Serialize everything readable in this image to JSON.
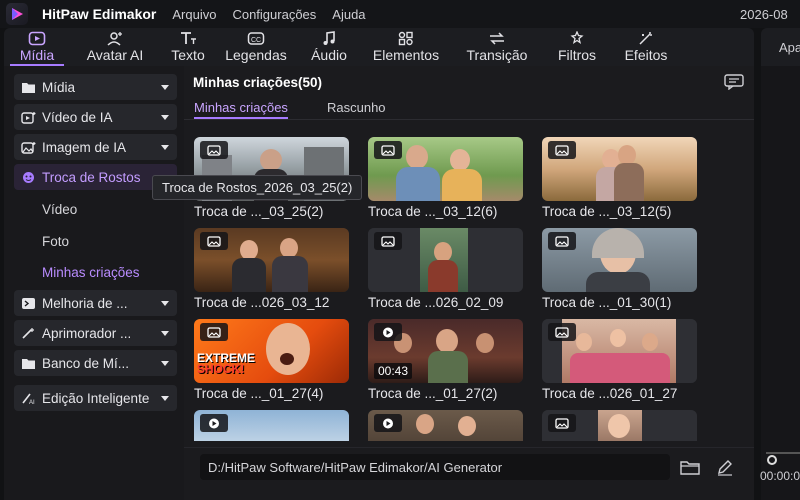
{
  "app": {
    "name": "HitPaw Edimakor",
    "date": "2026-08"
  },
  "menu": [
    "Arquivo",
    "Configurações",
    "Ajuda"
  ],
  "toolbar": [
    "Mídia",
    "Avatar AI",
    "Texto",
    "Legendas",
    "Áudio",
    "Elementos",
    "Transição",
    "Filtros",
    "Efeitos"
  ],
  "right_panel": {
    "label": "Apa"
  },
  "sidebar": {
    "items": [
      {
        "label": "Mídia"
      },
      {
        "label": "Vídeo de IA"
      },
      {
        "label": "Imagem de IA"
      },
      {
        "label": "Troca de Rostos"
      },
      {
        "label": "Melhoria de ..."
      },
      {
        "label": "Aprimorador ..."
      },
      {
        "label": "Banco de Mí..."
      },
      {
        "label": "Edição Inteligente"
      }
    ],
    "subitems": [
      "Vídeo",
      "Foto",
      "Minhas criações"
    ]
  },
  "main": {
    "title": "Minhas criações(50)",
    "tabs": [
      "Minhas criações",
      "Rascunho"
    ],
    "tooltip": "Troca de Rostos_2026_03_25(2)",
    "path": "D:/HitPaw Software/HitPaw Edimakor/AI Generator",
    "cards": [
      {
        "caption": "Troca de ..._03_25(2)",
        "kind": "image"
      },
      {
        "caption": "Troca de ..._03_12(6)",
        "kind": "image"
      },
      {
        "caption": "Troca de ..._03_12(5)",
        "kind": "image"
      },
      {
        "caption": "Troca de ...026_03_12",
        "kind": "image"
      },
      {
        "caption": "Troca de ...026_02_09",
        "kind": "image"
      },
      {
        "caption": "Troca de ..._01_30(1)",
        "kind": "image"
      },
      {
        "caption": "Troca de ..._01_27(4)",
        "kind": "image",
        "overlay": [
          "EXTREME",
          "SHOCK!"
        ]
      },
      {
        "caption": "Troca de ..._01_27(2)",
        "kind": "video",
        "duration": "00:43"
      },
      {
        "caption": "Troca de ...026_01_27",
        "kind": "image"
      },
      {
        "caption": "",
        "kind": "video"
      },
      {
        "caption": "",
        "kind": "video"
      },
      {
        "caption": "",
        "kind": "image"
      }
    ]
  },
  "timeline": {
    "time": "00:00:0"
  },
  "colors": {
    "accent": "#a77bff",
    "background": "#1b1b1e"
  }
}
